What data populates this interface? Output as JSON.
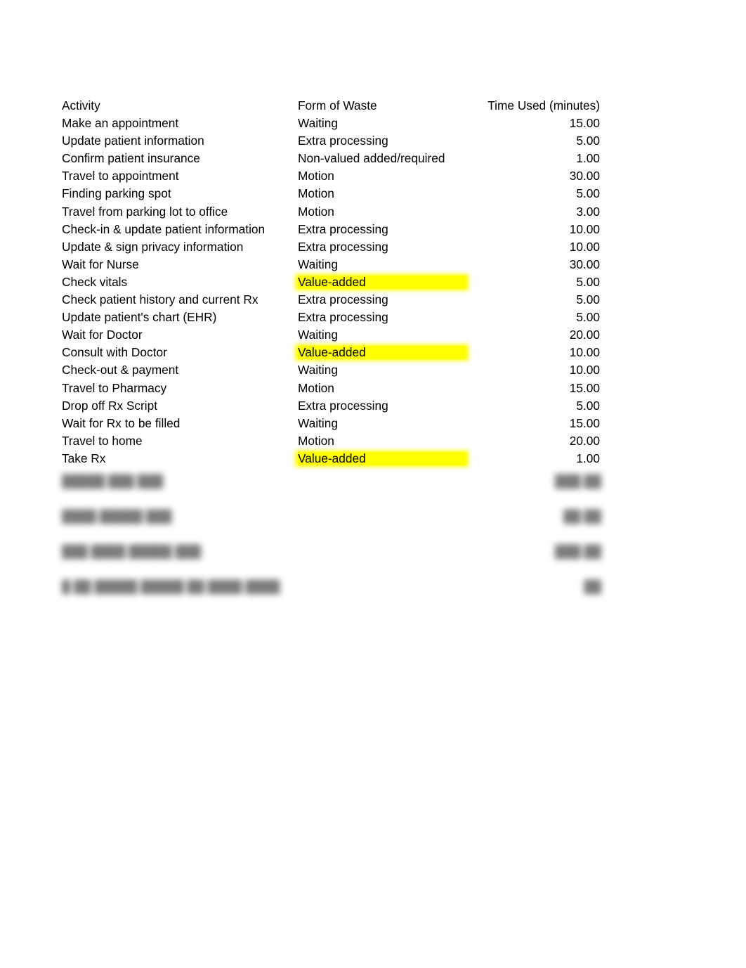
{
  "table": {
    "headers": {
      "activity": "Activity",
      "waste": "Form of Waste",
      "time": "Time Used (minutes)"
    },
    "rows": [
      {
        "activity": "Make an appointment",
        "waste": "Waiting",
        "time": "15.00",
        "highlight": false
      },
      {
        "activity": "Update patient information",
        "waste": "Extra processing",
        "time": "5.00",
        "highlight": false
      },
      {
        "activity": "Confirm patient insurance",
        "waste": "Non-valued added/required",
        "time": "1.00",
        "highlight": false
      },
      {
        "activity": "Travel to appointment",
        "waste": "Motion",
        "time": "30.00",
        "highlight": false
      },
      {
        "activity": "Finding parking spot",
        "waste": "Motion",
        "time": "5.00",
        "highlight": false
      },
      {
        "activity": "Travel from parking lot to office",
        "waste": "Motion",
        "time": "3.00",
        "highlight": false
      },
      {
        "activity": "Check-in & update patient information",
        "waste": "Extra processing",
        "time": "10.00",
        "highlight": false
      },
      {
        "activity": "Update & sign privacy information",
        "waste": "Extra processing",
        "time": "10.00",
        "highlight": false
      },
      {
        "activity": "Wait for Nurse",
        "waste": "Waiting",
        "time": "30.00",
        "highlight": false
      },
      {
        "activity": "Check vitals",
        "waste": "Value-added",
        "time": "5.00",
        "highlight": true
      },
      {
        "activity": "Check patient history and current Rx",
        "waste": "Extra processing",
        "time": "5.00",
        "highlight": false
      },
      {
        "activity": "Update patient's chart (EHR)",
        "waste": "Extra processing",
        "time": "5.00",
        "highlight": false
      },
      {
        "activity": "Wait for Doctor",
        "waste": "Waiting",
        "time": "20.00",
        "highlight": false
      },
      {
        "activity": "Consult with Doctor",
        "waste": "Value-added",
        "time": "10.00",
        "highlight": true
      },
      {
        "activity": "Check-out & payment",
        "waste": "Waiting",
        "time": "10.00",
        "highlight": false
      },
      {
        "activity": "Travel to Pharmacy",
        "waste": "Motion",
        "time": "15.00",
        "highlight": false
      },
      {
        "activity": "Drop off Rx Script",
        "waste": "Extra processing",
        "time": "5.00",
        "highlight": false
      },
      {
        "activity": "Wait for Rx to be filled",
        "waste": "Waiting",
        "time": "15.00",
        "highlight": false
      },
      {
        "activity": "Travel to home",
        "waste": "Motion",
        "time": "20.00",
        "highlight": false
      },
      {
        "activity": "Take Rx",
        "waste": "Value-added",
        "time": "1.00",
        "highlight": true
      }
    ]
  },
  "summary": {
    "rows": [
      {
        "label": "█████ ███ ███",
        "value": "███.██"
      },
      {
        "label": "████ █████ ███",
        "value": "██.██"
      },
      {
        "label": "███ ████ █████ ███",
        "value": "███.██"
      },
      {
        "label": "█ ██ █████ █████ ██ ████ ████",
        "value": "██"
      }
    ]
  },
  "colors": {
    "highlight": "#ffff00",
    "text": "#000000",
    "background": "#ffffff"
  }
}
